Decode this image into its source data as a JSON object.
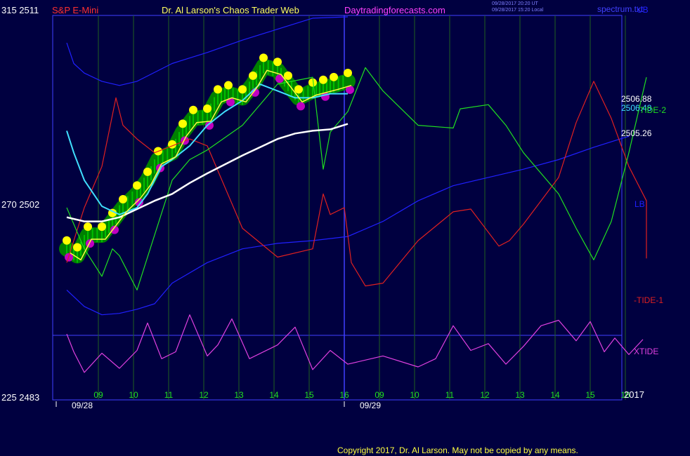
{
  "header": {
    "instrument": "S&P E-Mini",
    "title": "Dr. Al Larson's Chaos Trader Web",
    "site": "Daytradingforecasts.com",
    "stamp1": "09/28/2017 20:20 UT",
    "stamp2": "09/28/2017 15:20 Local",
    "tool": "spectrum.txt"
  },
  "y_axis": {
    "top": "315  2511",
    "mid": "270  2502",
    "bottom": "225  2483"
  },
  "price_labels": {
    "p1": "2506.88",
    "p2": "2506.48",
    "p3": "2505.26"
  },
  "series_labels": {
    "ub": "UB",
    "tide2": "-TIDE-2",
    "lb": "LB",
    "tide1": "-TIDE-1",
    "xtide": "XTIDE"
  },
  "year": "2017",
  "copyright": "Copyright 2017, Dr. Al Larson. May not be copied by any means.",
  "colors": {
    "background": "#000040",
    "price": "#00c000",
    "glow": "#008000",
    "yellow_dot": "#ffff00",
    "magenta_dot": "#c000c0",
    "white_ma": "#ffffff",
    "cyan_ma": "#40e0ff",
    "yellow_ma": "#ffff40",
    "band": "#2020ff",
    "tide1": "#e02020",
    "tide2": "#20e020",
    "xtide": "#e040e0",
    "grid": "#206020",
    "divider": "#4040ff",
    "red_text": "#ff3030"
  },
  "chart_data": {
    "type": "line",
    "x_ticks": [
      "09",
      "10",
      "11",
      "12",
      "13",
      "14",
      "15",
      "16",
      "09",
      "10",
      "11",
      "12",
      "13",
      "14",
      "15",
      "16"
    ],
    "dates": [
      "09/28",
      "09/29"
    ],
    "ylim": [
      2483,
      2511
    ],
    "series": [
      {
        "name": "UB",
        "points": [
          [
            0,
            2509
          ],
          [
            0.2,
            2507.5
          ],
          [
            0.5,
            2506.8
          ],
          [
            1,
            2506.2
          ],
          [
            1.5,
            2505.9
          ],
          [
            2,
            2506.2
          ],
          [
            3,
            2507.5
          ],
          [
            4,
            2508.3
          ],
          [
            5,
            2509.2
          ],
          [
            6,
            2510
          ],
          [
            7,
            2510.8
          ],
          [
            8,
            2510.9
          ]
        ]
      },
      {
        "name": "LB",
        "points": [
          [
            0,
            2491
          ],
          [
            0.5,
            2489.8
          ],
          [
            1,
            2489.2
          ],
          [
            1.5,
            2489.3
          ],
          [
            2,
            2489.6
          ],
          [
            2.5,
            2490
          ],
          [
            3,
            2491.5
          ],
          [
            4,
            2493
          ],
          [
            5,
            2494
          ],
          [
            6,
            2494.4
          ],
          [
            7,
            2494.6
          ],
          [
            8,
            2494.9
          ],
          [
            9,
            2496
          ],
          [
            10,
            2497.5
          ],
          [
            11,
            2498.6
          ],
          [
            12,
            2499.2
          ],
          [
            13,
            2499.8
          ],
          [
            14,
            2500.5
          ],
          [
            15,
            2501.4
          ],
          [
            16,
            2502.2
          ]
        ]
      },
      {
        "name": "-TIDE-1",
        "points": [
          [
            0,
            2493
          ],
          [
            0.5,
            2497
          ],
          [
            1,
            2500
          ],
          [
            1.4,
            2505
          ],
          [
            1.6,
            2503
          ],
          [
            2,
            2502
          ],
          [
            2.5,
            2501
          ],
          [
            3,
            2501.5
          ],
          [
            3.5,
            2502
          ],
          [
            4,
            2501.5
          ],
          [
            5,
            2495.5
          ],
          [
            6,
            2493.4
          ],
          [
            7,
            2494
          ],
          [
            7.3,
            2498
          ],
          [
            7.5,
            2496.5
          ],
          [
            7.9,
            2497
          ],
          [
            8.1,
            2493
          ],
          [
            8.5,
            2491.3
          ],
          [
            9,
            2491.5
          ],
          [
            10,
            2494.6
          ],
          [
            11,
            2496.7
          ],
          [
            11.5,
            2496.9
          ],
          [
            12.3,
            2494.2
          ],
          [
            12.6,
            2494.6
          ],
          [
            13,
            2495.8
          ],
          [
            14,
            2499.2
          ],
          [
            14.5,
            2503.2
          ],
          [
            15,
            2506.2
          ],
          [
            15.5,
            2503.5
          ],
          [
            16,
            2500
          ],
          [
            16.5,
            2497.5
          ],
          [
            16.5,
            2493.3
          ]
        ]
      },
      {
        "name": "-TIDE-2",
        "points": [
          [
            0,
            2497
          ],
          [
            0.5,
            2494
          ],
          [
            1,
            2492
          ],
          [
            1.3,
            2494
          ],
          [
            1.5,
            2493.5
          ],
          [
            2,
            2491
          ],
          [
            2.5,
            2495
          ],
          [
            3,
            2499
          ],
          [
            3.5,
            2500.5
          ],
          [
            4,
            2501.2
          ],
          [
            5,
            2503
          ],
          [
            6,
            2506
          ],
          [
            7,
            2506.5
          ],
          [
            7.3,
            2499.8
          ],
          [
            7.5,
            2502.5
          ],
          [
            8,
            2504
          ],
          [
            8.5,
            2507.2
          ],
          [
            9,
            2505.5
          ],
          [
            10,
            2503
          ],
          [
            11,
            2502.8
          ],
          [
            11.2,
            2504.2
          ],
          [
            12,
            2504.5
          ],
          [
            12.5,
            2503
          ],
          [
            13,
            2501
          ],
          [
            14,
            2498
          ],
          [
            14.5,
            2495.5
          ],
          [
            15,
            2493.2
          ],
          [
            15.5,
            2496
          ],
          [
            16,
            2501
          ],
          [
            16.5,
            2506.5
          ]
        ]
      },
      {
        "name": "XTIDE",
        "points": [
          [
            0,
            2487.8
          ],
          [
            0.2,
            2486.5
          ],
          [
            0.5,
            2485
          ],
          [
            1,
            2486.4
          ],
          [
            1.5,
            2485.3
          ],
          [
            2,
            2486.6
          ],
          [
            2.3,
            2488.6
          ],
          [
            2.7,
            2486
          ],
          [
            3.1,
            2486.5
          ],
          [
            3.5,
            2489.2
          ],
          [
            4,
            2486.2
          ],
          [
            4.3,
            2487
          ],
          [
            4.7,
            2488.9
          ],
          [
            5.2,
            2486
          ],
          [
            6,
            2487
          ],
          [
            6.5,
            2488.3
          ],
          [
            7,
            2485.2
          ],
          [
            7.5,
            2486.6
          ],
          [
            8,
            2485.6
          ],
          [
            9,
            2486.2
          ],
          [
            10,
            2485.4
          ],
          [
            10.5,
            2486
          ],
          [
            11,
            2488.4
          ],
          [
            11.5,
            2486.6
          ],
          [
            12,
            2487.1
          ],
          [
            12.5,
            2485.6
          ],
          [
            13,
            2486.9
          ],
          [
            13.5,
            2488.4
          ],
          [
            14,
            2488.8
          ],
          [
            14.5,
            2487.3
          ],
          [
            14.9,
            2488.7
          ],
          [
            15.3,
            2486.5
          ],
          [
            15.6,
            2487.5
          ],
          [
            16,
            2486.3
          ],
          [
            16.4,
            2487.4
          ]
        ]
      },
      {
        "name": "price",
        "points": [
          [
            0,
            2494
          ],
          [
            0.3,
            2493.5
          ],
          [
            0.6,
            2495
          ],
          [
            1,
            2495
          ],
          [
            1.3,
            2496
          ],
          [
            1.6,
            2497
          ],
          [
            2,
            2498
          ],
          [
            2.3,
            2499
          ],
          [
            2.6,
            2500.5
          ],
          [
            3,
            2501
          ],
          [
            3.3,
            2502.5
          ],
          [
            3.6,
            2503.5
          ],
          [
            4,
            2503.6
          ],
          [
            4.3,
            2505
          ],
          [
            4.6,
            2505.3
          ],
          [
            5,
            2505
          ],
          [
            5.3,
            2506
          ],
          [
            5.6,
            2507.3
          ],
          [
            6,
            2507
          ],
          [
            6.3,
            2506
          ],
          [
            6.6,
            2505
          ],
          [
            7,
            2505.5
          ],
          [
            7.3,
            2505.7
          ],
          [
            7.6,
            2505.9
          ],
          [
            8,
            2506.2
          ]
        ]
      },
      {
        "name": "white_ma",
        "points": [
          [
            0,
            2496.3
          ],
          [
            0.5,
            2496
          ],
          [
            1,
            2496
          ],
          [
            1.5,
            2496.3
          ],
          [
            2,
            2496.9
          ],
          [
            2.5,
            2497.5
          ],
          [
            3,
            2498
          ],
          [
            3.5,
            2498.8
          ],
          [
            4,
            2499.5
          ],
          [
            5,
            2500.8
          ],
          [
            6,
            2502
          ],
          [
            6.5,
            2502.4
          ],
          [
            7,
            2502.6
          ],
          [
            7.5,
            2502.7
          ],
          [
            8,
            2503.1
          ]
        ]
      },
      {
        "name": "cyan_ma",
        "points": [
          [
            0,
            2502.6
          ],
          [
            0.2,
            2501
          ],
          [
            0.5,
            2499
          ],
          [
            1,
            2497.1
          ],
          [
            1.5,
            2496.5
          ],
          [
            2,
            2497
          ],
          [
            2.3,
            2498
          ],
          [
            2.7,
            2500
          ],
          [
            3,
            2500.5
          ],
          [
            3.5,
            2501.5
          ],
          [
            4,
            2503
          ],
          [
            4.5,
            2504
          ],
          [
            5,
            2504.8
          ],
          [
            5.5,
            2506
          ],
          [
            6,
            2505.5
          ],
          [
            6.5,
            2505
          ],
          [
            7,
            2505
          ],
          [
            7.5,
            2505.3
          ],
          [
            8,
            2505.3
          ]
        ]
      }
    ]
  }
}
